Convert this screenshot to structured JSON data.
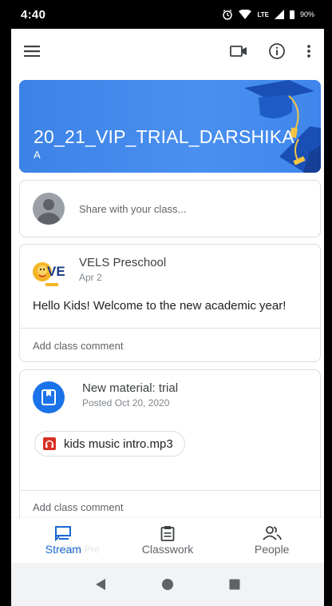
{
  "status_bar": {
    "time": "4:40",
    "battery": "90%",
    "network": "LTE"
  },
  "app_bar": {
    "menu_icon": "hamburger-menu-icon",
    "video_icon": "video-camera-icon",
    "info_icon": "info-icon",
    "more_icon": "more-vert-icon"
  },
  "banner": {
    "title": "20_21_VIP_TRIAL_DARSHIKA",
    "subtitle": "A",
    "color": "#4285f4"
  },
  "share": {
    "placeholder": "Share with your class..."
  },
  "posts": [
    {
      "author": "VELS Preschool",
      "date": "Apr 2",
      "body": "Hello Kids! Welcome to the new academic year!",
      "comment_label": "Add class comment",
      "logo_text": "VE"
    },
    {
      "title": "New material: trial",
      "date": "Posted Oct 20, 2020",
      "attachment": "kids music intro.mp3",
      "comment_label": "Add class comment"
    }
  ],
  "bottom_nav": {
    "items": [
      {
        "label": "Stream",
        "icon": "stream-icon",
        "active": true
      },
      {
        "label": "Classwork",
        "icon": "classwork-icon",
        "active": false
      },
      {
        "label": "People",
        "icon": "people-icon",
        "active": false
      }
    ],
    "active_color": "#1967d2"
  },
  "ghost_text": "VELS Pre"
}
